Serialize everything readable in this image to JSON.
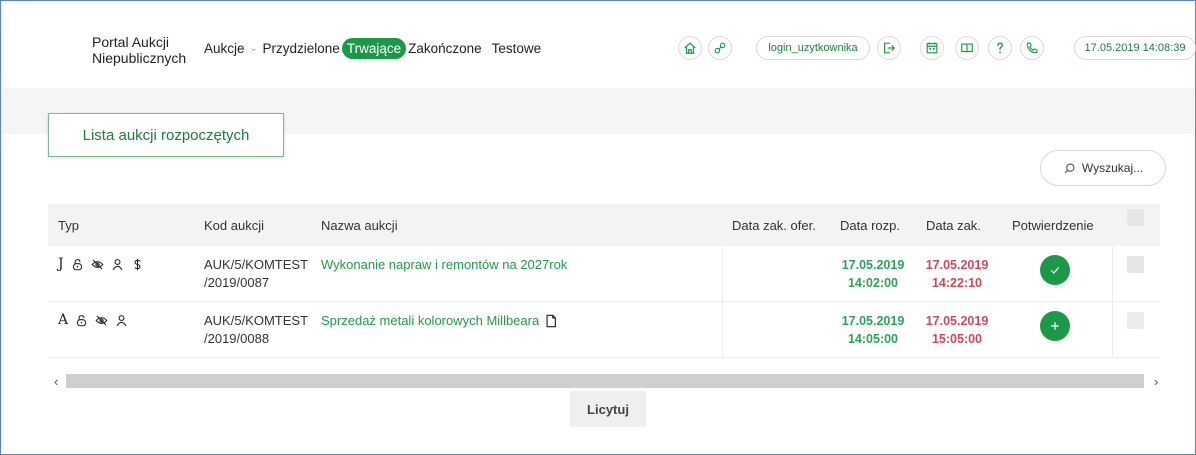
{
  "header": {
    "brand_line1": "Portal Aukcji",
    "brand_line2": "Niepublicznych",
    "nav": [
      {
        "label": "Aukcje"
      },
      {
        "label": "Przydzielone"
      },
      {
        "label": "Trwające"
      },
      {
        "label": "Zakończone"
      },
      {
        "label": "Testowe"
      }
    ],
    "user_login": "login_uzytkownika",
    "datetime": "17.05.2019 14:08:39"
  },
  "section_title": "Lista aukcji rozpoczętych",
  "search_label": "Wyszukaj...",
  "table": {
    "headers": {
      "typ": "Typ",
      "kod": "Kod aukcji",
      "nazwa": "Nazwa aukcji",
      "data_zak_ofer": "Data zak. ofer.",
      "data_rozp": "Data rozp.",
      "data_zak": "Data zak.",
      "potwierdzenie": "Potwierdzenie"
    },
    "rows": [
      {
        "typ_letter": "J",
        "kod_line1": "AUK/5/KOMTEST",
        "kod_line2": "/2019/0087",
        "nazwa": "Wykonanie napraw i remontów na 2027rok",
        "rozp_date": "17.05.2019",
        "rozp_time": "14:02:00",
        "zak_date": "17.05.2019",
        "zak_time": "14:22:10"
      },
      {
        "typ_letter": "A",
        "kod_line1": "AUK/5/KOMTEST",
        "kod_line2": "/2019/0088",
        "nazwa": "Sprzedaż metali kolorowych Millbeara",
        "rozp_date": "17.05.2019",
        "rozp_time": "14:05:00",
        "zak_date": "17.05.2019",
        "zak_time": "15:05:00"
      }
    ]
  },
  "action_button": "Licytuj",
  "colors": {
    "accent": "#1a9a47",
    "date_start": "#27a35a",
    "date_end": "#d9435a"
  }
}
